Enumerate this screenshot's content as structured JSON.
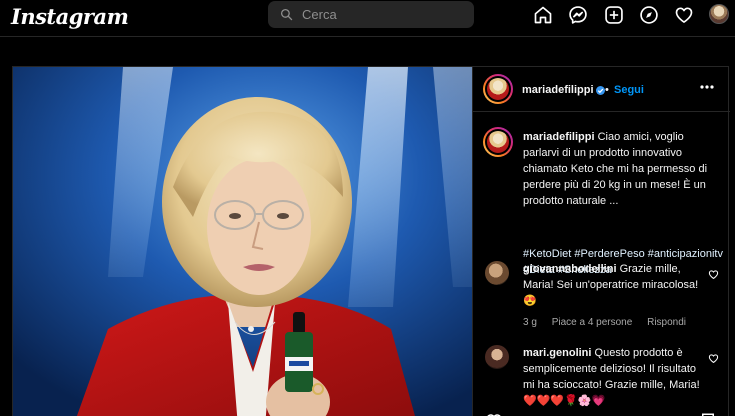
{
  "app": {
    "logo_text": "Instagram"
  },
  "search": {
    "placeholder": "Cerca"
  },
  "nav": [
    {
      "name": "home-icon"
    },
    {
      "name": "messenger-icon"
    },
    {
      "name": "new-post-icon"
    },
    {
      "name": "explore-icon"
    },
    {
      "name": "activity-heart-icon"
    },
    {
      "name": "profile-avatar"
    }
  ],
  "post": {
    "username": "mariadefilippi",
    "verified": true,
    "follow_label": "Segui",
    "separator": "•",
    "caption_username": "mariadefilippi",
    "caption_text": "Ciao amici, voglio parlarvi di un prodotto innovativo chiamato Keto che mi ha permesso di perdere più di 20 kg in un mese! È un prodotto naturale ...",
    "hashtags": "#KetoDiet #PerderePeso #anticipazionitv #Dieta #Snellezza"
  },
  "comments": [
    {
      "username": "giovannabodellini",
      "text": "Grazie mille, Maria! Sei un'operatrice miracolosa!",
      "emoji": "😍",
      "time": "3 g",
      "likes": "Piace a 4 persone",
      "reply": "Rispondi"
    },
    {
      "username": "mari.genolini",
      "text": "Questo prodotto è semplicemente delizioso! Il risultato mi ha scioccato! Grazie mille, Maria!",
      "emoji": "❤️❤️❤️🌹🌸💗"
    }
  ],
  "colors": {
    "accent": "#0095f6",
    "verified": "#3897f0",
    "background": "#000000",
    "border": "#262626",
    "muted": "#a8a8a8"
  }
}
